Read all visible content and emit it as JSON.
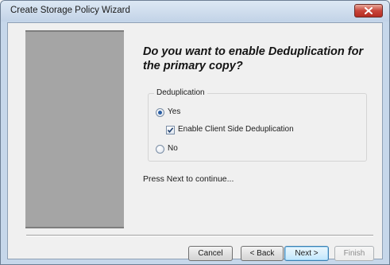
{
  "window": {
    "title": "Create Storage Policy Wizard"
  },
  "page": {
    "question": "Do you want to enable Deduplication for the primary copy?",
    "group_label": "Deduplication",
    "option_yes": "Yes",
    "option_yes_selected": true,
    "client_side_dedup_label": "Enable Client Side Deduplication",
    "client_side_dedup_checked": true,
    "option_no": "No",
    "option_no_selected": false,
    "continue_text": "Press Next to continue..."
  },
  "buttons": {
    "cancel": "Cancel",
    "back": "< Back",
    "next": "Next >",
    "finish": "Finish"
  },
  "colors": {
    "close_button": "#c8453a",
    "side_panel": "#a5a5a5",
    "primary_button_border": "#3c7fb1"
  }
}
